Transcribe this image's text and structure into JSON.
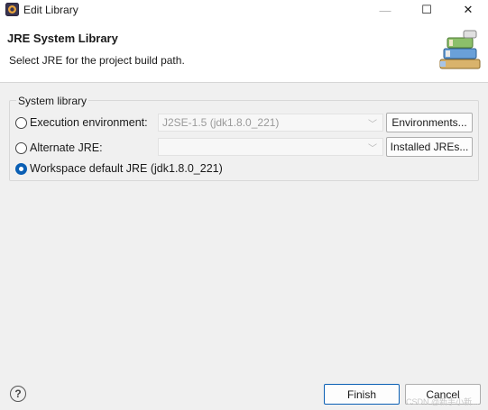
{
  "window": {
    "title": "Edit Library",
    "minimize": "—",
    "maximize": "☐",
    "close": "✕"
  },
  "banner": {
    "title": "JRE System Library",
    "description": "Select JRE for the project build path."
  },
  "system_library": {
    "legend": "System library",
    "options": [
      {
        "label": "Execution environment:",
        "selected": false,
        "combo_value": "J2SE-1.5 (jdk1.8.0_221)",
        "button": "Environments..."
      },
      {
        "label": "Alternate JRE:",
        "selected": false,
        "combo_value": "",
        "button": "Installed JREs..."
      },
      {
        "label": "Workspace default JRE (jdk1.8.0_221)",
        "selected": true
      }
    ]
  },
  "footer": {
    "help": "?",
    "finish": "Finish",
    "cancel": "Cancel",
    "watermark": "CSDN @新手小新..."
  },
  "colors": {
    "accent": "#0a5fb4",
    "background": "#f0f0f0"
  }
}
